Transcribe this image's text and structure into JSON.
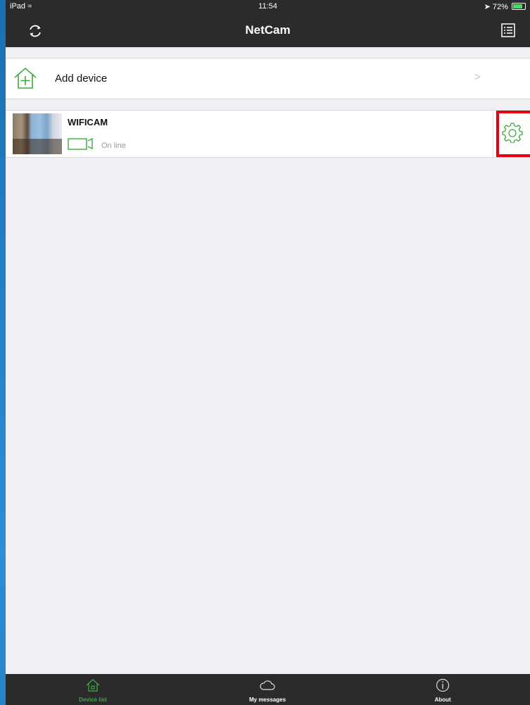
{
  "status_bar": {
    "carrier": "iPad",
    "time": "11:54",
    "battery": "72%",
    "battery_level": 0.72
  },
  "nav": {
    "title": "NetCam",
    "refresh_icon": "refresh-icon",
    "menu_icon": "list-icon"
  },
  "add_device": {
    "label": "Add device",
    "icon": "add-house-icon",
    "chevron": ">"
  },
  "devices": [
    {
      "name": "WIFICAM",
      "status": "On line",
      "status_icon": "video-camera-icon",
      "settings_icon": "gear-icon"
    }
  ],
  "tabs": [
    {
      "label": "Device list",
      "icon": "home-icon",
      "active": true
    },
    {
      "label": "My messages",
      "icon": "cloud-icon",
      "active": false
    },
    {
      "label": "About",
      "icon": "info-icon",
      "active": false
    }
  ],
  "colors": {
    "accent": "#3fa93f",
    "highlight": "#e60012",
    "bar": "#2b2b2b"
  }
}
